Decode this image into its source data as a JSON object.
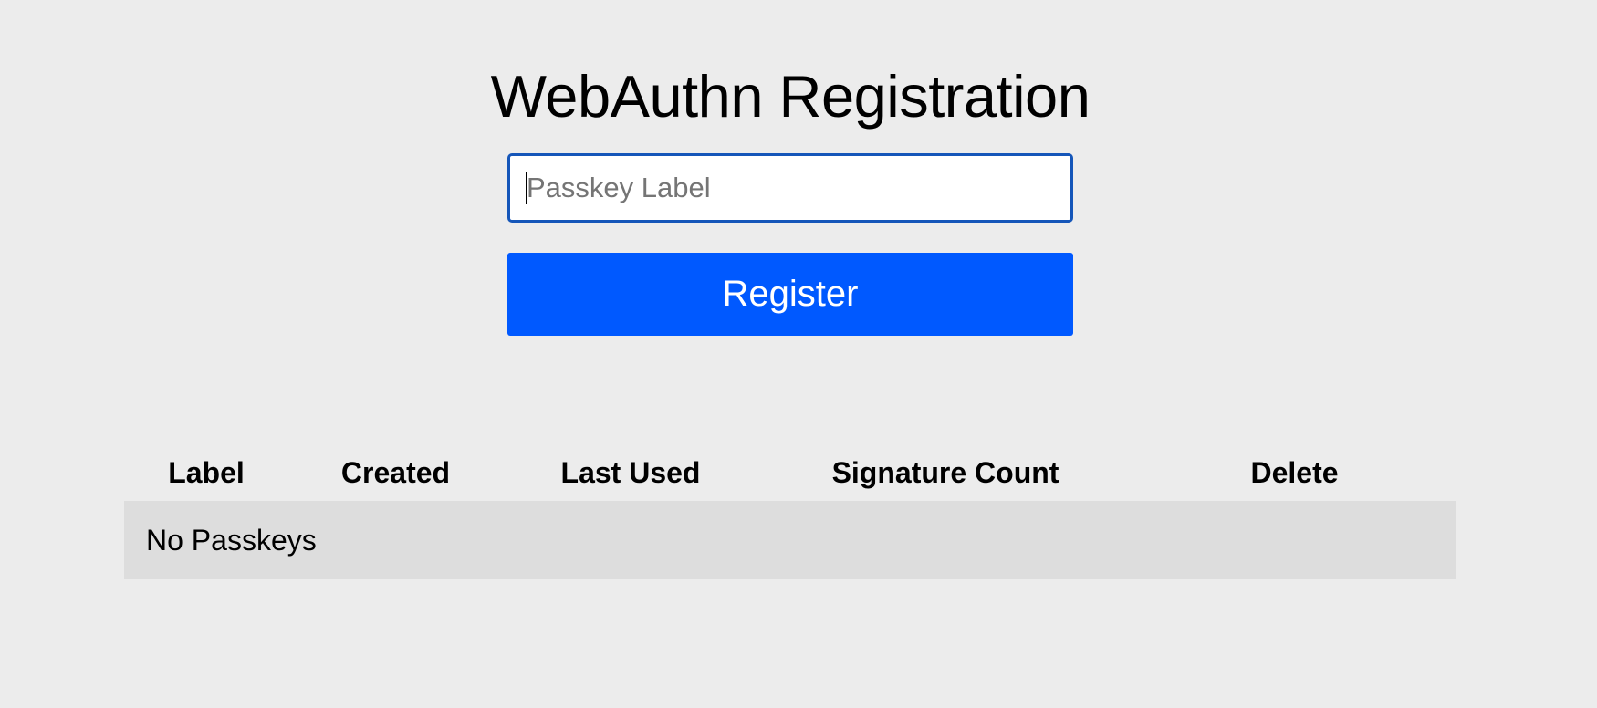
{
  "page": {
    "title": "WebAuthn Registration"
  },
  "form": {
    "input_placeholder": "Passkey Label",
    "input_value": "",
    "register_label": "Register"
  },
  "table": {
    "columns": [
      "Label",
      "Created",
      "Last Used",
      "Signature Count",
      "Delete"
    ],
    "empty_message": "No Passkeys"
  },
  "colors": {
    "background": "#ececec",
    "button": "#0059ff",
    "input_border": "#1556b9",
    "empty_row": "#dddddd"
  }
}
